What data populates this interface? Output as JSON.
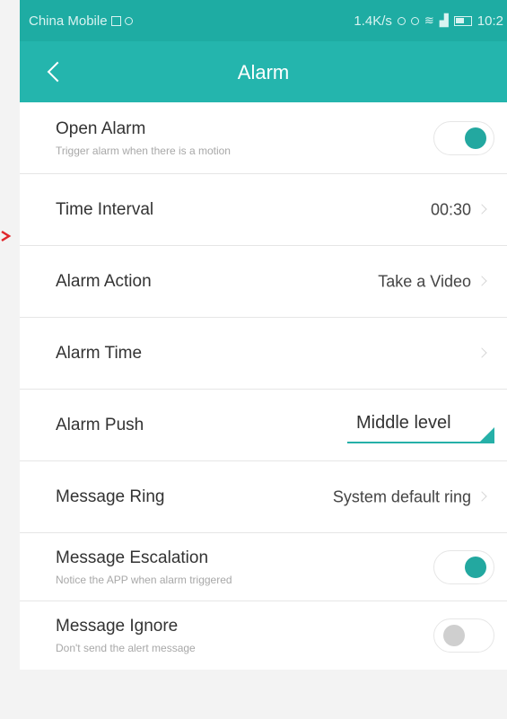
{
  "status_bar": {
    "carrier": "China Mobile",
    "speed": "1.4K/s",
    "time": "10:2"
  },
  "header": {
    "title": "Alarm",
    "back_icon": "chevron-left-icon"
  },
  "settings": {
    "open_alarm": {
      "label": "Open Alarm",
      "description": "Trigger alarm when there is a motion",
      "enabled": true
    },
    "time_interval": {
      "label": "Time Interval",
      "value": "00:30"
    },
    "alarm_action": {
      "label": "Alarm Action",
      "value": "Take a Video"
    },
    "alarm_time": {
      "label": "Alarm Time"
    },
    "alarm_push": {
      "label": "Alarm Push",
      "selected": "Middle level"
    },
    "message_ring": {
      "label": "Message Ring",
      "value": "System default ring"
    },
    "message_escalation": {
      "label": "Message Escalation",
      "description": "Notice the APP when alarm triggered",
      "enabled": true
    },
    "message_ignore": {
      "label": "Message Ignore",
      "description": "Don't send the alert message",
      "enabled": false
    }
  },
  "colors": {
    "accent": "#24b5ad",
    "status_bar": "#1eaca3",
    "toggle_on": "#23a8a0",
    "toggle_off": "#cfcfcf",
    "annotation_arrow": "#e0262b"
  }
}
